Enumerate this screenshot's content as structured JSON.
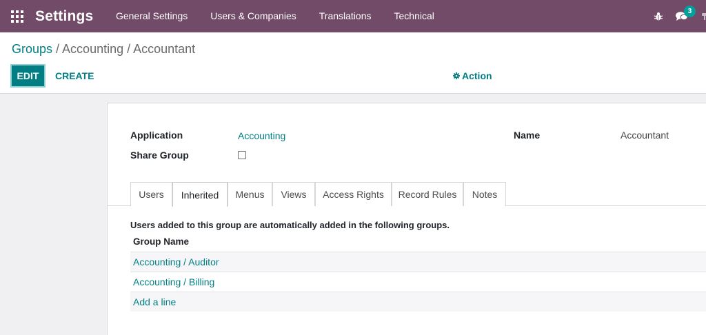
{
  "navbar": {
    "app_title": "Settings",
    "menu": [
      "General Settings",
      "Users & Companies",
      "Translations",
      "Technical"
    ],
    "messages_badge": "3",
    "icons": [
      "apps-grid-icon",
      "bug-icon",
      "chat-icon"
    ]
  },
  "breadcrumb": {
    "root": "Groups",
    "separator1": " / ",
    "current": "Accounting / Accountant"
  },
  "actions": {
    "edit": "EDIT",
    "create": "CREATE",
    "action": "Action"
  },
  "form": {
    "application_label": "Application",
    "application_value": "Accounting",
    "share_group_label": "Share Group",
    "share_group_checked": false,
    "name_label": "Name",
    "name_value": "Accountant"
  },
  "tabs": {
    "items": [
      "Users",
      "Inherited",
      "Menus",
      "Views",
      "Access Rights",
      "Record Rules",
      "Notes"
    ],
    "active": "Inherited"
  },
  "inherited": {
    "note": "Users added to this group are automatically added in the following groups.",
    "column_header": "Group Name",
    "rows": [
      "Accounting / Auditor",
      "Accounting / Billing"
    ],
    "add_line": "Add a line"
  },
  "colors": {
    "navbar": "#714b67",
    "accent": "#017e84",
    "badge": "#00a09d"
  }
}
